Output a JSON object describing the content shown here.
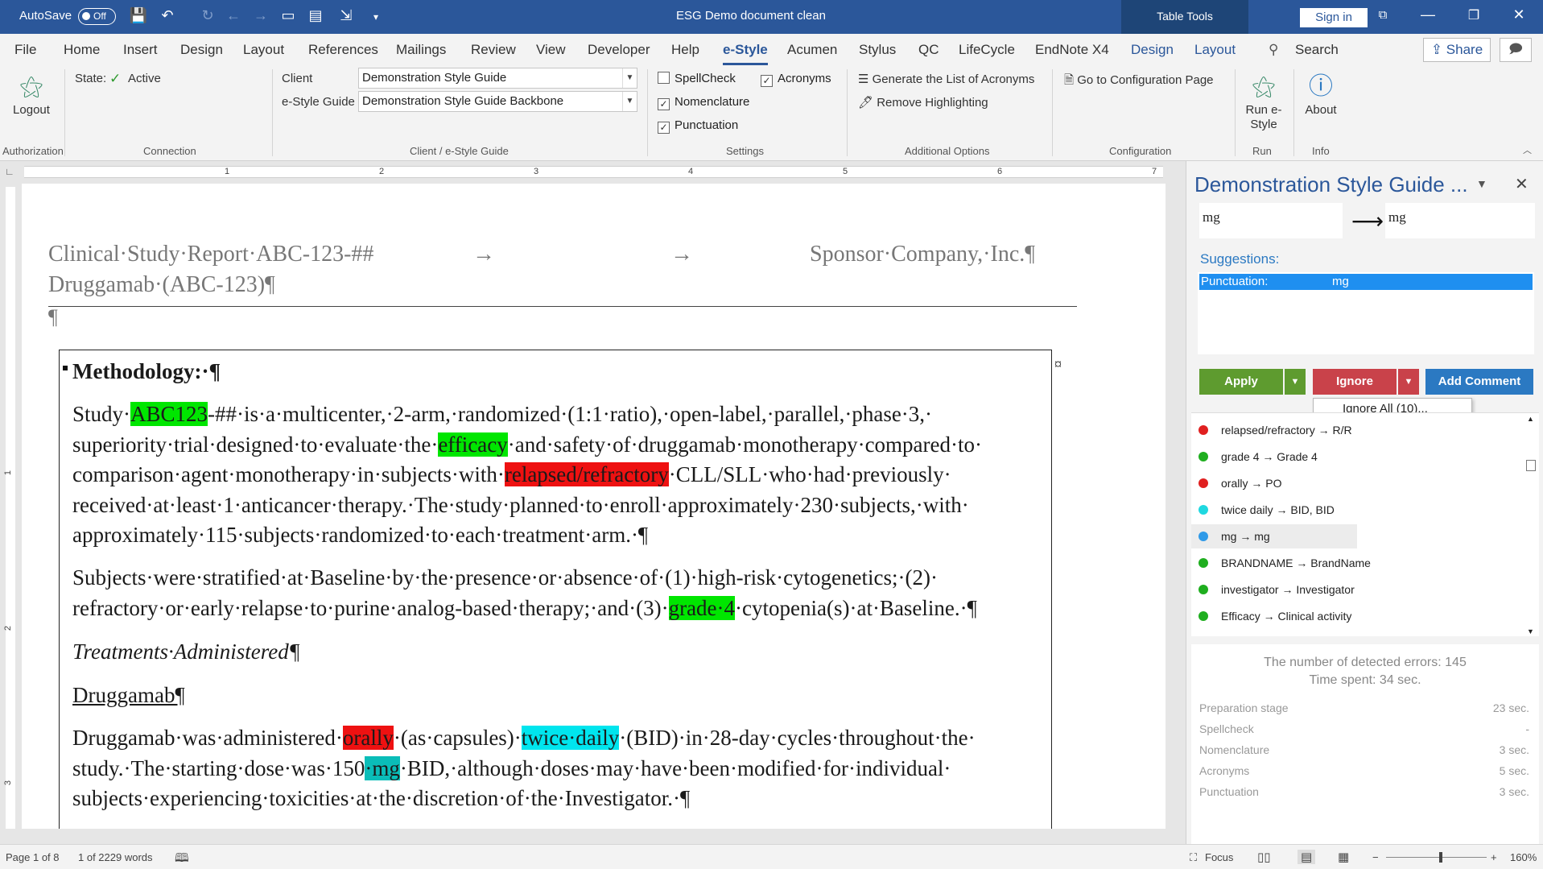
{
  "titlebar": {
    "autosave": "AutoSave",
    "autosave_state": "Off",
    "doc_title": "ESG Demo document clean",
    "table_tools": "Table Tools",
    "signin": "Sign in"
  },
  "menu": {
    "tabs": [
      "File",
      "Home",
      "Insert",
      "Design",
      "Layout",
      "References",
      "Mailings",
      "Review",
      "View",
      "Developer",
      "Help",
      "e-Style",
      "Acumen",
      "Stylus",
      "QC",
      "LifeCycle",
      "EndNote X4",
      "Design",
      "Layout"
    ],
    "active_tab": "e-Style",
    "search": "Search",
    "share": "Share"
  },
  "ribbon": {
    "logout": "Logout",
    "state_label": "State:",
    "state_value": "Active",
    "client_label": "Client",
    "client_value": "Demonstration Style Guide",
    "guide_label": "e-Style Guide",
    "guide_value": "Demonstration Style Guide Backbone",
    "spellcheck": "SpellCheck",
    "acronyms": "Acronyms",
    "nomenclature": "Nomenclature",
    "punctuation": "Punctuation",
    "generate_acronyms": "Generate the List of Acronyms",
    "remove_highlighting": "Remove Highlighting",
    "config_page": "Go to Configuration Page",
    "run_line1": "Run e-",
    "run_line2": "Style",
    "about": "About",
    "groups": {
      "authorization": "Authorization",
      "connection": "Connection",
      "client_guide": "Client / e-Style Guide",
      "settings": "Settings",
      "additional": "Additional Options",
      "configuration": "Configuration",
      "run": "Run",
      "info": "Info"
    }
  },
  "ruler": {
    "h_numbers": [
      "1",
      "2",
      "3",
      "4",
      "5",
      "6",
      "7"
    ],
    "v_numbers": [
      "1",
      "2",
      "3"
    ]
  },
  "document": {
    "header_left_1": "Clinical·Study·Report·ABC-123-##",
    "header_left_2": "Druggamab·(ABC-123)¶",
    "header_right": "Sponsor·Company,·Inc.¶",
    "header_tab": "→",
    "pilcrow": "¶",
    "methodology": "Methodology:·¶",
    "p1": {
      "l1a": "Study·",
      "l1hl": "ABC123",
      "l1b": "-##·is·a·multicenter,·2-arm,·randomized·(1:1·ratio),·open-label,·parallel,·phase·3,·",
      "l2a": "superiority·trial·designed·to·evaluate·the·",
      "l2hl": "efficacy",
      "l2b": "·and·safety·of·druggamab·monotherapy·compared·to·",
      "l3a": "comparison·agent·monotherapy·in·subjects·with·",
      "l3hl": "relapsed/refractory",
      "l3b": "·CLL/SLL·who·had·previously·",
      "l4": "received·at·least·1·anticancer·therapy.·The·study·planned·to·enroll·approximately·230·subjects,·with·",
      "l5": "approximately·115·subjects·randomized·to·each·treatment·arm.·¶"
    },
    "p2": {
      "l1": "Subjects·were·stratified·at·Baseline·by·the·presence·or·absence·of·(1)·high-risk·cytogenetics;·(2)·",
      "l2a": "refractory·or·early·relapse·to·purine·analog-based·therapy;·and·(3)·",
      "l2hl": "grade·4",
      "l2b": "·cytopenia(s)·at·Baseline.·¶"
    },
    "treatments": "Treatments·Administered¶",
    "druggamab": "Druggamab¶",
    "p3": {
      "l1a": "Druggamab·was·administered·",
      "l1hl1": "orally",
      "l1b": "·(as·capsules)·",
      "l1hl2": "twice·daily",
      "l1c": "·(BID)·in·28-day·cycles·throughout·the·",
      "l2a": "study.·The·starting·dose·was·150",
      "l2hl": "·mg",
      "l2b": "·BID,·although·doses·may·have·been·modified·for·individual·",
      "l3": "subjects·experiencing·toxicities·at·the·discretion·of·the·Investigator.·¶"
    }
  },
  "pane": {
    "title": "Demonstration Style Guide ...",
    "from": "mg",
    "to": "mg",
    "suggestions_label": "Suggestions:",
    "suggestion_kind": "Punctuation:",
    "suggestion_value": "mg",
    "apply": "Apply",
    "ignore": "Ignore",
    "add_comment": "Add Comment",
    "ignore_all": "Ignore All (10)...",
    "errors": [
      {
        "text": "relapsed/refractory → R/R",
        "color": "#e02020"
      },
      {
        "text": "grade 4 → Grade 4",
        "color": "#1fae1f"
      },
      {
        "text": "orally → PO",
        "color": "#e02020"
      },
      {
        "text": "twice daily → BID, BID",
        "color": "#1fd8e0"
      },
      {
        "text": " mg →  mg",
        "color": "#2f9ae8"
      },
      {
        "text": "BRANDNAME → BrandName",
        "color": "#1fae1f"
      },
      {
        "text": "investigator → Investigator",
        "color": "#1fae1f"
      },
      {
        "text": "Efficacy → Clinical activity",
        "color": "#1fae1f"
      }
    ],
    "selected_index": 4,
    "detected": "The number of detected errors: 145",
    "time_spent": "Time spent: 34 sec.",
    "stats": [
      {
        "label": "Preparation stage",
        "value": "23 sec."
      },
      {
        "label": "Spellcheck",
        "value": "-"
      },
      {
        "label": "Nomenclature",
        "value": "3 sec."
      },
      {
        "label": "Acronyms",
        "value": "5 sec."
      },
      {
        "label": "Punctuation",
        "value": "3 sec."
      }
    ]
  },
  "status": {
    "page": "Page 1 of 8",
    "words": "1 of 2229 words",
    "focus": "Focus",
    "zoom": "160%"
  }
}
